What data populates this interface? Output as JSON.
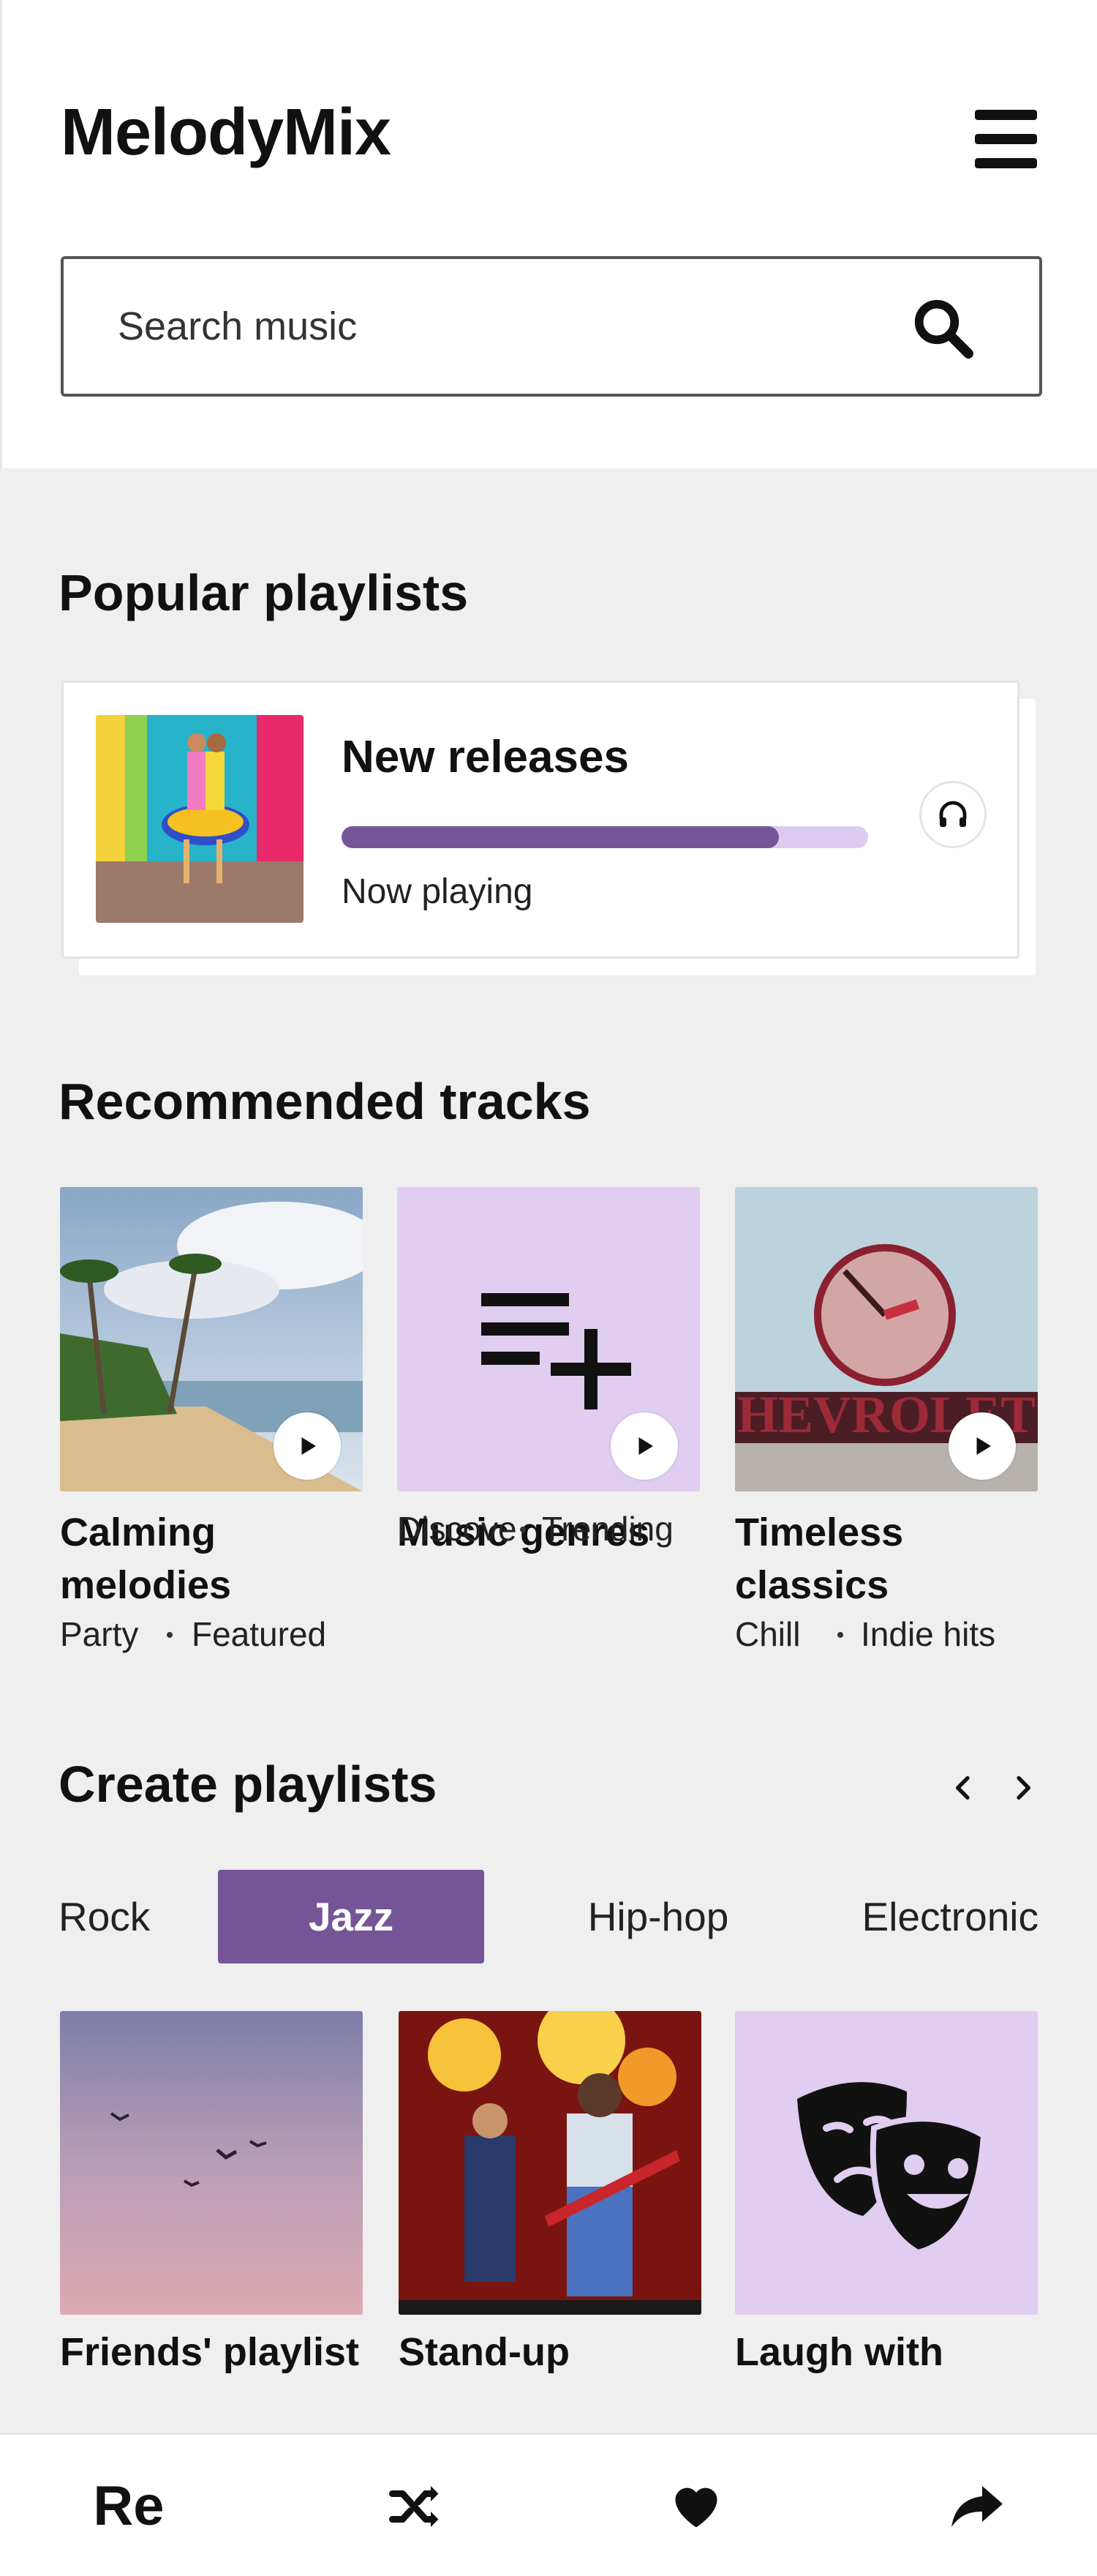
{
  "app": {
    "title": "MelodyMix"
  },
  "search": {
    "placeholder": "Search music"
  },
  "popular": {
    "heading": "Popular playlists",
    "card": {
      "title": "New releases",
      "status": "Now playing",
      "progress_fraction": 0.83
    }
  },
  "recommended": {
    "heading": "Recommended tracks",
    "tracks": [
      {
        "title_line1": "Calming",
        "title_line2": "melodies",
        "tags": [
          "Party",
          "Featured"
        ]
      },
      {
        "title_line1": "Music genres",
        "title_line2": "",
        "tags": [
          "Discove",
          "Trending"
        ]
      },
      {
        "title_line1": "Timeless",
        "title_line2": "classics",
        "tags": [
          "Chill",
          "Indie hits"
        ]
      }
    ]
  },
  "create": {
    "heading": "Create playlists",
    "chips": [
      "Rock",
      "Jazz",
      "Hip-hop",
      "Electronic"
    ],
    "active_chip": "Jazz",
    "cards": [
      {
        "title": "Friends' playlist"
      },
      {
        "title": "Stand-up"
      },
      {
        "title": "Laugh with"
      }
    ]
  },
  "bottom_bar": {
    "first_label": "Re",
    "icons": [
      "shuffle-icon",
      "heart-icon",
      "share-icon"
    ]
  },
  "colors": {
    "accent": "#755597",
    "accent_light": "#dccbf0",
    "tile_bg": "#e0cdf0",
    "background": "#efefef"
  }
}
